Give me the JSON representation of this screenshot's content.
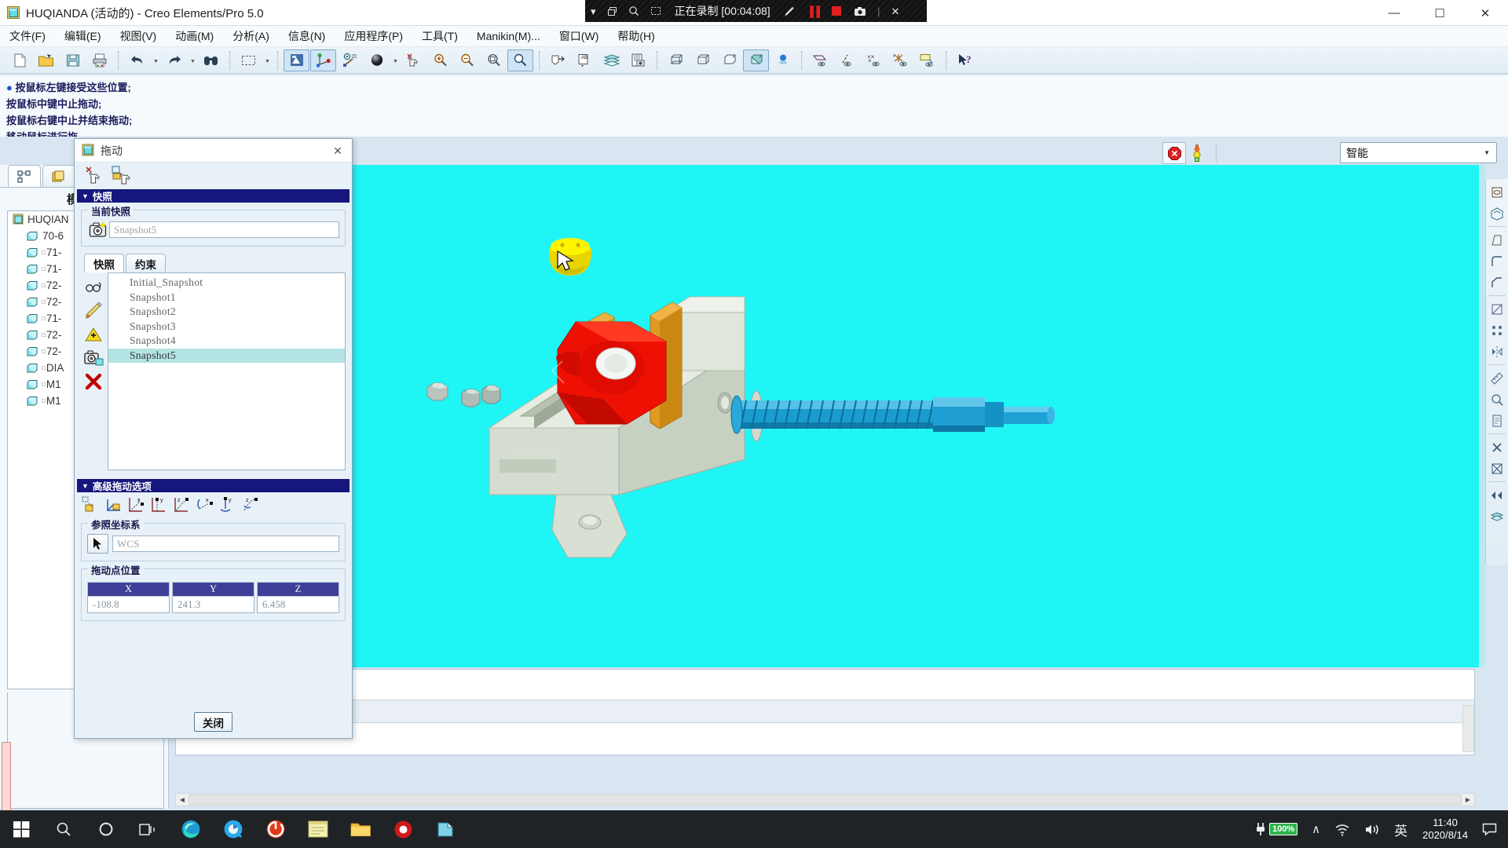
{
  "window": {
    "title": "HUQIANDA (活动的) - Creo Elements/Pro 5.0",
    "icon": "creo-window-icon",
    "buttons": {
      "minimize": "—",
      "maximize": "☐",
      "close": "✕"
    }
  },
  "recorder": {
    "status_text": "正在录制 [00:04:08]",
    "chevron": "▾",
    "window_icon": "restore-icon",
    "zoom_icon": "magnifier-icon",
    "region_icon": "region-icon",
    "pen_icon": "pencil-icon",
    "pause_icon": "▐▐",
    "stop_icon": "stop-square",
    "camera_icon": "camera-icon",
    "close_icon": "✕"
  },
  "menubar": [
    {
      "label": "文件(F)",
      "name": "menu-file"
    },
    {
      "label": "编辑(E)",
      "name": "menu-edit"
    },
    {
      "label": "视图(V)",
      "name": "menu-view"
    },
    {
      "label": "动画(M)",
      "name": "menu-animation"
    },
    {
      "label": "分析(A)",
      "name": "menu-analysis"
    },
    {
      "label": "信息(N)",
      "name": "menu-info"
    },
    {
      "label": "应用程序(P)",
      "name": "menu-applications"
    },
    {
      "label": "工具(T)",
      "name": "menu-tools"
    },
    {
      "label": "Manikin(M)...",
      "name": "menu-manikin"
    },
    {
      "label": "窗口(W)",
      "name": "menu-window"
    },
    {
      "label": "帮助(H)",
      "name": "menu-help"
    }
  ],
  "toolbar": {
    "icons": [
      "new-file-icon",
      "open-folder-icon",
      "save-icon",
      "print-icon",
      "undo-icon",
      "redo-icon",
      "find-binoculars-icon",
      "select-box-icon",
      "repaint-icon",
      "datum-axes-icon",
      "layer-point-icon",
      "shaded-sphere-icon",
      "spin-center-off-icon",
      "zoom-in-icon",
      "zoom-out-icon",
      "refit-icon",
      "reorient-icon",
      "annotation-icon",
      "layers-icon",
      "view-manager-icon",
      "display-wireframe-icon",
      "display-hidden-line-icon",
      "display-no-hidden-icon",
      "display-shaded-icon",
      "light-sphere-icon",
      "datum-plane-display-icon",
      "datum-axis-display-icon",
      "datum-point-display-icon",
      "datum-csys-display-icon",
      "annotation-display-icon",
      "help-pointer-icon"
    ]
  },
  "message_area": {
    "lines": [
      "按鼠标左键接受这些位置;",
      "按鼠标中键中止拖动;",
      "按鼠标右键中止并结束拖动;",
      "移动鼠标进行拖"
    ],
    "bullet": "●"
  },
  "model_tree": {
    "title": "模型树",
    "tabs": [
      "model-tree-tab",
      "layer-tree-tab"
    ],
    "root": {
      "label": "HUQIAN",
      "icon": "assembly-icon"
    },
    "items": [
      {
        "label": "70-6",
        "sup": "",
        "icon": "part-icon"
      },
      {
        "label": "71-",
        "sup": "□",
        "icon": "part-icon"
      },
      {
        "label": "71-",
        "sup": "□",
        "icon": "part-icon"
      },
      {
        "label": "72-",
        "sup": "□",
        "icon": "part-icon"
      },
      {
        "label": "72-",
        "sup": "□",
        "icon": "part-icon"
      },
      {
        "label": "71-",
        "sup": "□",
        "icon": "part-icon"
      },
      {
        "label": "72-",
        "sup": "□",
        "icon": "part-icon"
      },
      {
        "label": "72-",
        "sup": "□",
        "icon": "part-icon"
      },
      {
        "label": "DIA",
        "sup": "□",
        "icon": "part-icon"
      },
      {
        "label": "M1",
        "sup": "□",
        "icon": "part-icon"
      },
      {
        "label": "M1",
        "sup": "□",
        "icon": "part-icon"
      }
    ]
  },
  "topright": {
    "stop_icon": "stop-regeneration-icon",
    "lamp_icon": "traffic-light-icon",
    "filter_value": "智能",
    "filter_caret": "▼"
  },
  "right_toolbar": {
    "icons": [
      "hole-icon",
      "shell-icon",
      "draft-icon",
      "round-icon",
      "chamfer-icon",
      "rib-icon",
      "pattern-icon",
      "mirror-icon",
      "measure-icon",
      "analysis-icon",
      "delete-icon",
      "suppress-icon",
      "prev-next-icon",
      "layer-icon"
    ]
  },
  "dialog": {
    "title": "拖动",
    "icon": "drag-dialog-icon",
    "close": "✕",
    "tools": [
      "point-drag-icon",
      "body-drag-icon"
    ],
    "snapshot_section": {
      "header": "快照",
      "triangle": "▼",
      "current_group_label": "当前快照",
      "current_value": "Snapshot5",
      "camera_icon": "take-snapshot-icon",
      "tabs": [
        {
          "label": "快照",
          "selected": true
        },
        {
          "label": "约束",
          "selected": false
        }
      ],
      "side_tools": [
        "show-snapshot-icon",
        "edit-snapshot-icon",
        "update-snapshot-icon",
        "copy-snapshot-icon",
        "delete-snapshot-icon"
      ],
      "list": [
        {
          "label": "Initial_Snapshot",
          "selected": false
        },
        {
          "label": "Snapshot1",
          "selected": false
        },
        {
          "label": "Snapshot2",
          "selected": false
        },
        {
          "label": "Snapshot3",
          "selected": false
        },
        {
          "label": "Snapshot4",
          "selected": false
        },
        {
          "label": "Snapshot5",
          "selected": true
        }
      ]
    },
    "advanced_section": {
      "header": "高级拖动选项",
      "triangle": "▼",
      "tools": [
        "body-point-drag-icon",
        "body-plane-drag-icon",
        "x-translate-icon",
        "y-translate-icon",
        "z-translate-icon",
        "x-rotate-icon",
        "y-rotate-icon",
        "z-rotate-icon"
      ],
      "csys_group_label": "参照坐标系",
      "csys_pick_icon": "select-arrow-icon",
      "csys_value": "WCS",
      "point_group_label": "拖动点位置",
      "coord_headers": [
        "X",
        "Y",
        "Z"
      ],
      "coord_values": [
        "-108.8",
        "241.3",
        "6.458"
      ]
    },
    "close_button": "关闭"
  },
  "graphics": {
    "background_color": "#1ff5f5",
    "cursor": "arrow-cursor",
    "parts": [
      {
        "name": "dragged-yellow-part",
        "color": "#ffe800"
      },
      {
        "name": "vise-body",
        "color": "#dde5d8"
      },
      {
        "name": "red-clamp-part",
        "color": "#f01000"
      },
      {
        "name": "orange-jaw-plate",
        "color": "#e8a030"
      },
      {
        "name": "blue-lead-screw",
        "color": "#1696c8"
      },
      {
        "name": "washer",
        "color": "#cfd8d4"
      },
      {
        "name": "nut-1",
        "color": "#c8d2cc"
      },
      {
        "name": "nut-2",
        "color": "#c8d2cc"
      }
    ]
  },
  "taskbar": {
    "items": [
      "start-windows-icon",
      "search-icon",
      "cortana-icon",
      "task-view-icon",
      "edge-browser-icon",
      "browser-2-icon",
      "creo-app-icon",
      "notepad-app-icon",
      "file-explorer-icon",
      "recorder-app-icon",
      "unknown-app-icon"
    ],
    "tray": {
      "power_icon": "power-plug-icon",
      "battery_text": "100%",
      "chevron_up": "∧",
      "wifi_icon": "wifi-icon",
      "volume_icon": "speaker-icon",
      "ime_text": "英",
      "time": "11:40",
      "date": "2020/8/14",
      "notification_icon": "notification-icon"
    }
  }
}
